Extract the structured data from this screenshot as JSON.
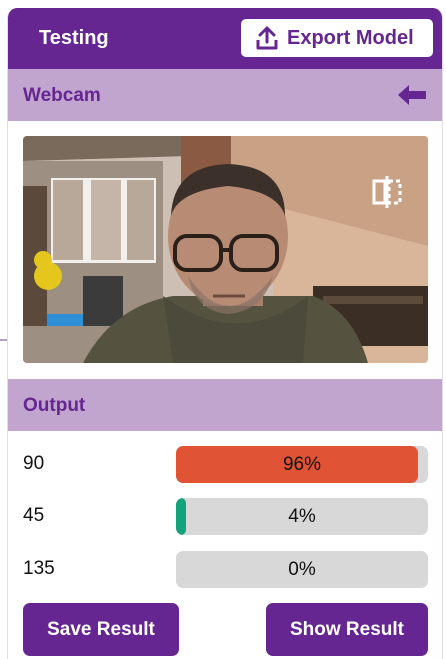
{
  "header": {
    "title": "Testing",
    "export_label": "Export Model",
    "export_icon": "upload-icon"
  },
  "webcam": {
    "title": "Webcam",
    "back_icon": "arrow-left-icon",
    "flip_icon": "flip-horizontal-icon"
  },
  "output": {
    "title": "Output",
    "rows": [
      {
        "label": "90",
        "percent": 96,
        "percent_text": "96%",
        "color": "#e05335"
      },
      {
        "label": "45",
        "percent": 4,
        "percent_text": "4%",
        "color": "#14a27c"
      },
      {
        "label": "135",
        "percent": 0,
        "percent_text": "0%",
        "color": "#8a8a8a"
      }
    ]
  },
  "actions": {
    "save_label": "Save Result",
    "show_label": "Show Result"
  },
  "colors": {
    "primary": "#652692",
    "section_bg": "#c1a5ce",
    "bar_track": "#d8d8d8"
  }
}
